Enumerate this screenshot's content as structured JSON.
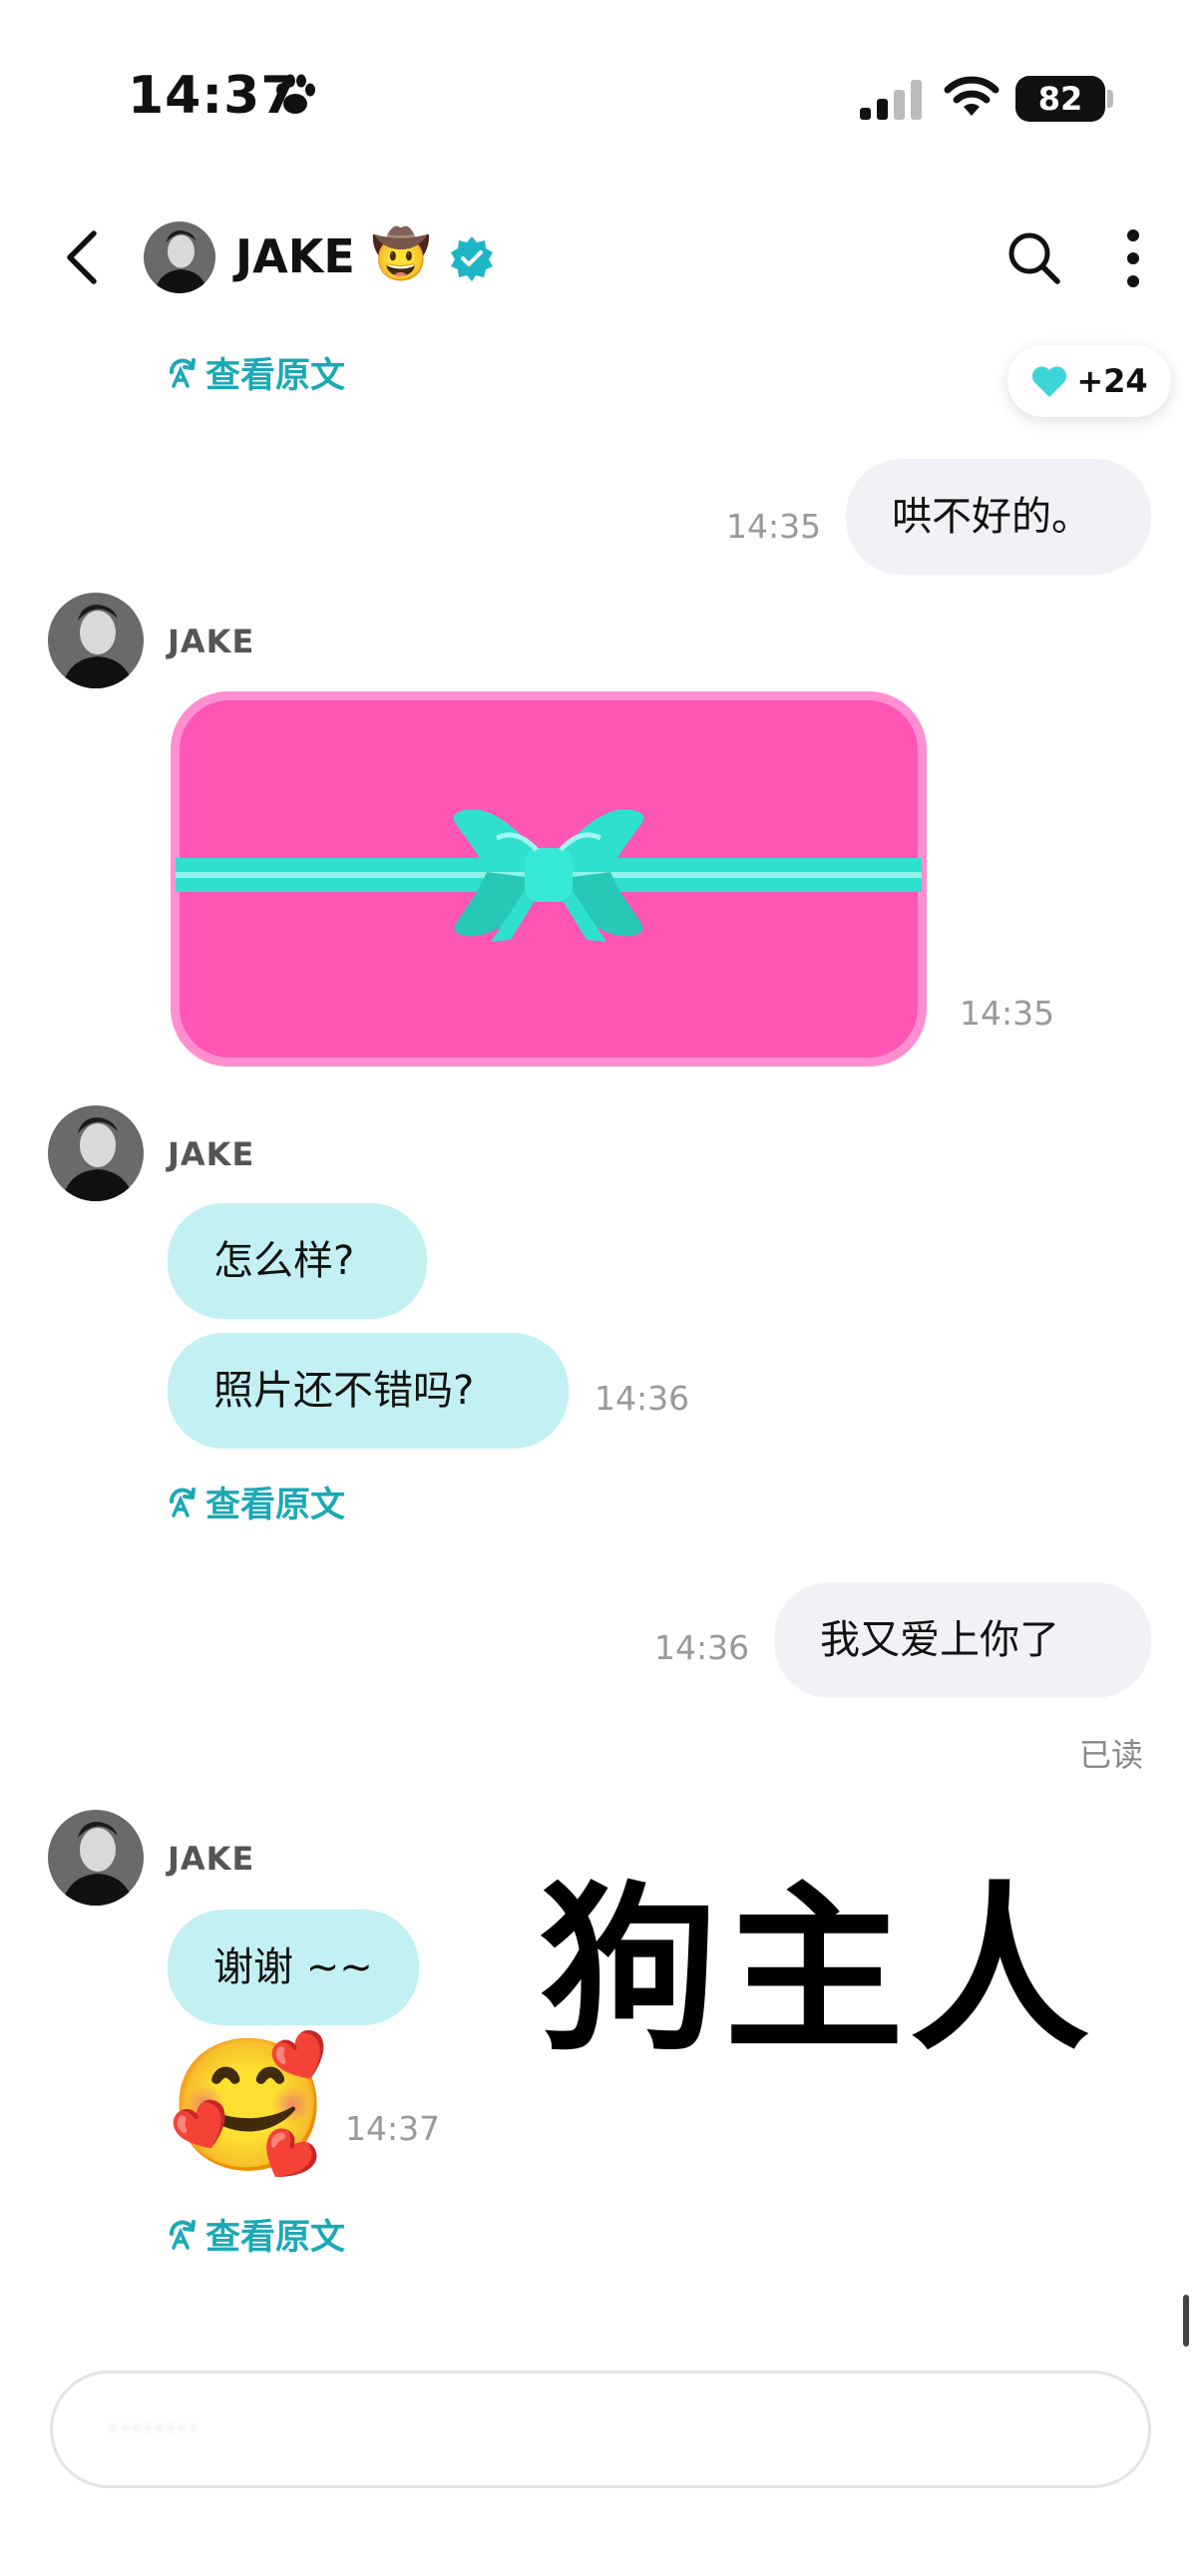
{
  "status_bar": {
    "time": "14:37",
    "battery": "82"
  },
  "header": {
    "contact_name": "JAKE",
    "name_emoji": "🤠"
  },
  "reaction": {
    "count": "+24"
  },
  "translate_label": "查看原文",
  "messages": [
    {
      "side": "out",
      "text": "哄不好的。",
      "time": "14:35"
    },
    {
      "side": "in",
      "sender": "JAKE",
      "type": "gift",
      "time": "14:35"
    },
    {
      "side": "in",
      "sender": "JAKE",
      "text": "怎么样?"
    },
    {
      "side": "in",
      "text": "照片还不错吗?",
      "time": "14:36"
    },
    {
      "side": "out",
      "text": "我又爱上你了",
      "time": "14:36",
      "status": "已读"
    },
    {
      "side": "in",
      "sender": "JAKE",
      "text": "谢谢 ~~"
    },
    {
      "side": "in",
      "type": "emoji",
      "text": "🥰",
      "time": "14:37"
    }
  ],
  "overlay_caption": "狗主人",
  "input": {
    "text": "········"
  },
  "colors": {
    "accent": "#1aa9b5",
    "incoming_bubble": "#c2f0f3",
    "outgoing_bubble": "#f0f2f5",
    "gift_pink": "#ff55b4",
    "gift_ribbon": "#2fe0cf"
  }
}
